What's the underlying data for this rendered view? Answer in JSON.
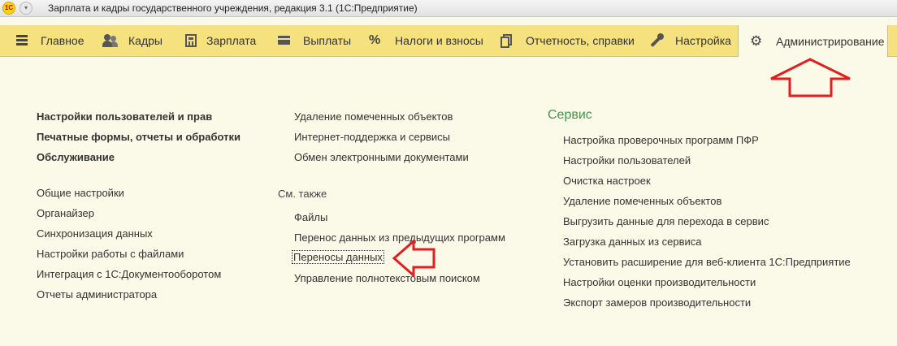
{
  "window": {
    "title": "Зарплата и кадры государственного учреждения, редакция 3.1  (1С:Предприятие)",
    "logo_text": "1С"
  },
  "sections": [
    {
      "label": "Главное",
      "icon": "menu-icon"
    },
    {
      "label": "Кадры",
      "icon": "staff-icon"
    },
    {
      "label": "Зарплата",
      "icon": "calculator-icon"
    },
    {
      "label": "Выплаты",
      "icon": "wallet-icon"
    },
    {
      "label": "Налоги и взносы",
      "icon": "percent-icon"
    },
    {
      "label": "Отчетность, справки",
      "icon": "reports-icon"
    },
    {
      "label": "Настройка",
      "icon": "wrench-icon"
    },
    {
      "label": "Администрирование",
      "icon": "gear-icon",
      "active": true
    }
  ],
  "col1": {
    "bold_links": [
      "Настройки пользователей и прав",
      "Печатные формы, отчеты и обработки",
      "Обслуживание"
    ],
    "links": [
      "Общие настройки",
      "Органайзер",
      "Синхронизация данных",
      "Настройки работы с файлами",
      "Интеграция с 1С:Документооборотом",
      "Отчеты администратора"
    ]
  },
  "col2": {
    "links": [
      "Удаление помеченных объектов",
      "Интернет-поддержка и сервисы",
      "Обмен электронными документами"
    ],
    "see_also_title": "См. также",
    "see_also": [
      "Файлы",
      "Перенос данных из предыдущих программ",
      "Переносы данных",
      "Управление полнотекстовым поиском"
    ]
  },
  "col3": {
    "title": "Сервис",
    "links": [
      "Настройка проверочных программ ПФР",
      "Настройки пользователей",
      "Очистка настроек",
      "Удаление помеченных объектов",
      "Выгрузить данные для перехода в сервис",
      "Загрузка данных из сервиса",
      "Установить расширение для веб-клиента 1С:Предприятие",
      "Настройки оценки производительности",
      "Экспорт замеров производительности"
    ]
  },
  "colors": {
    "section_bar": "#f5e27e",
    "background": "#fbf9e7",
    "service_title": "#3a9a4b",
    "annotation_arrow": "#e02020"
  }
}
